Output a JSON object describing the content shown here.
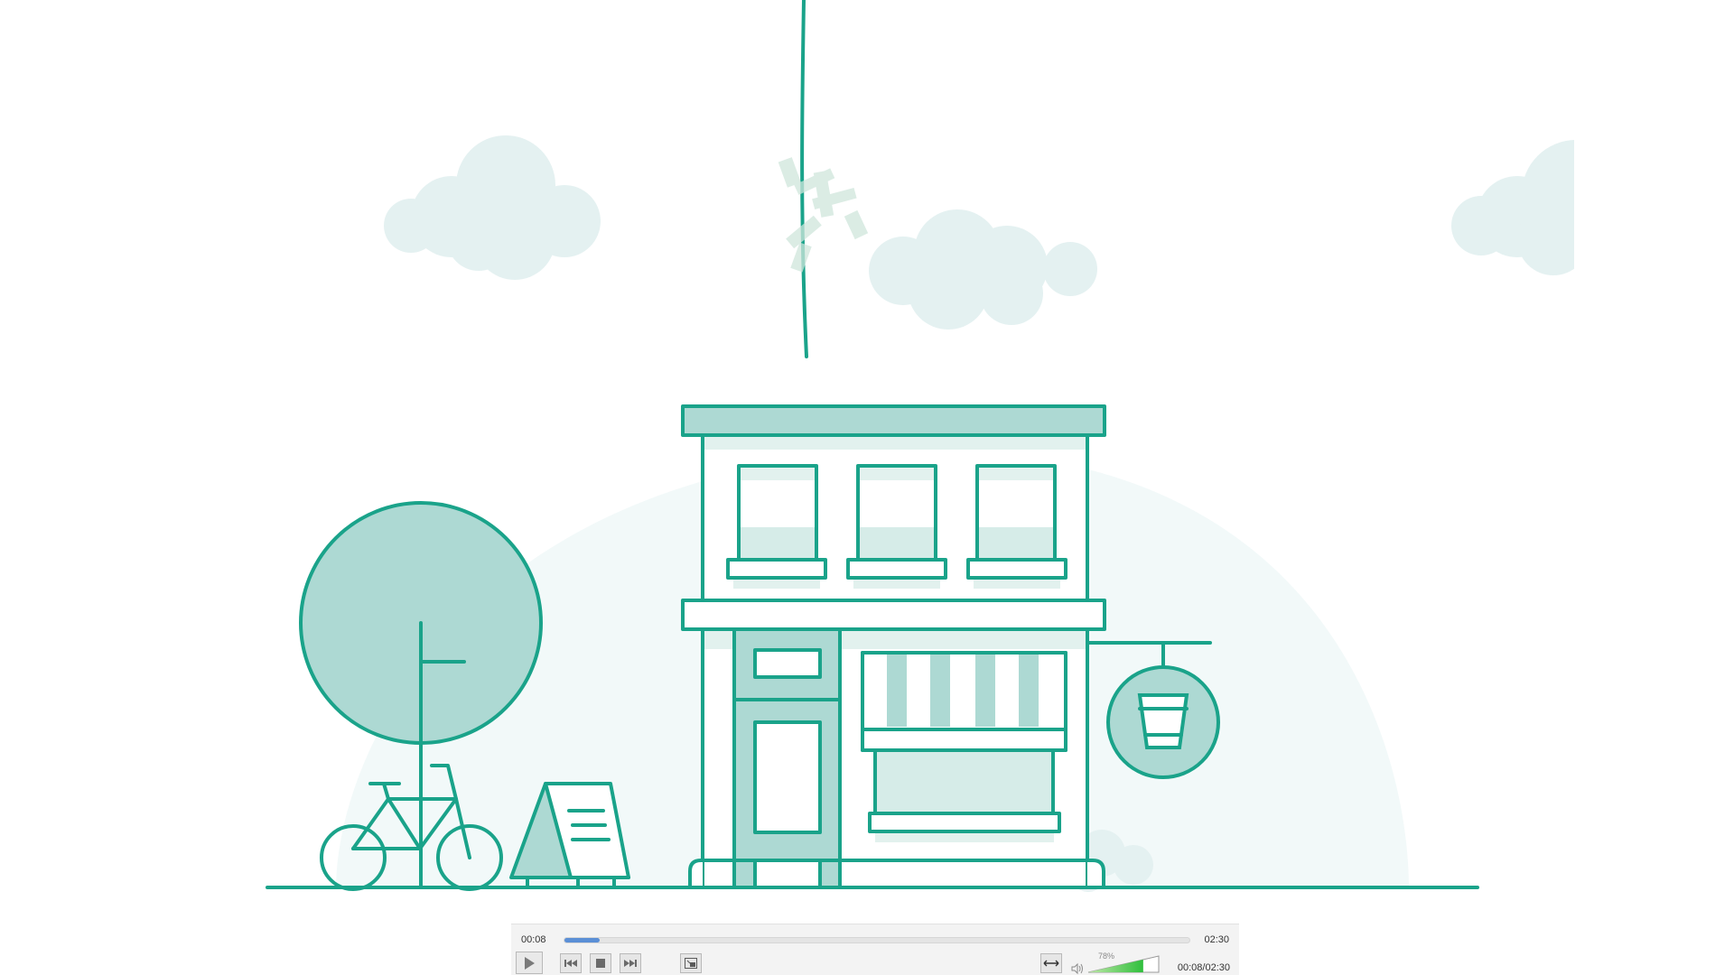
{
  "player": {
    "current_time": "00:08",
    "total_time": "02:30",
    "combined_time": "00:08/02:30",
    "progress": 0.057,
    "volume_label": "78%",
    "volume": 0.78,
    "controls": {
      "play_icon": "play-icon",
      "prev_icon": "previous-icon",
      "stop_icon": "stop-icon",
      "next_icon": "next-icon",
      "fullscreen_icon": "fullscreen-icon",
      "aspect_icon": "aspect-ratio-icon",
      "volume_icon": "speaker-icon"
    }
  },
  "scene": {
    "primary_color": "#1aa38a",
    "fill_color": "#add9d3",
    "light_fill": "#d6ece8",
    "cloud_color": "#e4f1f1",
    "hill_color": "#f2f9f9",
    "icons": [
      "building-icon",
      "tree-icon",
      "bicycle-icon",
      "sign-board-icon",
      "cafe-sign-icon",
      "cup-icon",
      "cloud-icon",
      "rope-icon"
    ]
  }
}
